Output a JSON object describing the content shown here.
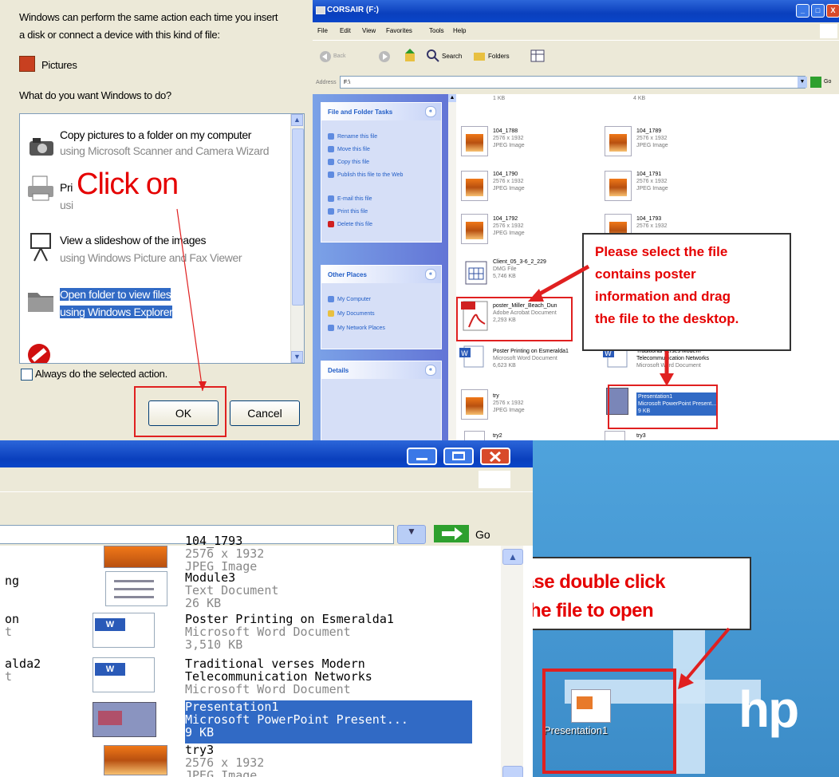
{
  "autoplay": {
    "intro_line1": "Windows can perform the same action each time you insert",
    "intro_line2": "a disk or connect a device with this kind of file:",
    "content_type": "Pictures",
    "question": "What do you want Windows to do?",
    "options": [
      {
        "line1": "Copy pictures to a folder on my computer",
        "line2": "using Microsoft Scanner and Camera Wizard"
      },
      {
        "line1": "Pri",
        "line2": "usi"
      },
      {
        "line1": "View a slideshow of the images",
        "line2": "using Windows Picture and Fax Viewer"
      },
      {
        "line1": "Open folder to view files",
        "line2": "using Windows Explorer"
      }
    ],
    "checkbox_label": "Always do the selected action.",
    "ok_label": "OK",
    "cancel_label": "Cancel",
    "annotation": "Click on"
  },
  "explorer": {
    "title": "CORSAIR (F:)",
    "menu": [
      "File",
      "Edit",
      "View",
      "Favorites",
      "Tools",
      "Help"
    ],
    "toolbar": {
      "back": "Back",
      "search": "Search",
      "folders": "Folders"
    },
    "address_label": "Address",
    "address_value": "F:\\",
    "go_label": "Go",
    "file_tasks_header": "File and Folder Tasks",
    "file_tasks": [
      "Rename this file",
      "Move this file",
      "Copy this file",
      "Publish this file to the Web",
      "E-mail this file",
      "Print this file",
      "Delete this file"
    ],
    "other_places_header": "Other Places",
    "other_places": [
      "My Computer",
      "My Documents",
      "My Network Places"
    ],
    "details_header": "Details",
    "files": [
      {
        "name": "104_1788",
        "l2": "2576 x 1932",
        "l3": "JPEG Image"
      },
      {
        "name": "104_1789",
        "l2": "2576 x 1932",
        "l3": "JPEG Image"
      },
      {
        "name": "104_1790",
        "l2": "2576 x 1932",
        "l3": "JPEG Image"
      },
      {
        "name": "104_1791",
        "l2": "2576 x 1932",
        "l3": "JPEG Image"
      },
      {
        "name": "104_1792",
        "l2": "2576 x 1932",
        "l3": "JPEG Image"
      },
      {
        "name": "104_1793",
        "l2": "2576 x 1932",
        "l3": ""
      },
      {
        "name": "Client_05_3-6_2_229",
        "l2": "DMG File",
        "l3": "5,746 KB"
      },
      {
        "name": "poster_Miller_Beach_Dun",
        "l2": "Adobe Acrobat Document",
        "l3": "2,293 KB"
      },
      {
        "name": "Poster Printing on Esmeralda1",
        "l2": "Microsoft Word Document",
        "l3": "6,623 KB"
      },
      {
        "name": "Traditional verses Modern",
        "l2": "Telecommunication Networks",
        "l3": "Microsoft Word Document"
      },
      {
        "name": "try",
        "l2": "2576 x 1932",
        "l3": "JPEG Image"
      },
      {
        "name": "Presentation1",
        "l2": "Microsoft PowerPoint Present...",
        "l3": "9 KB"
      },
      {
        "name": "try2",
        "l2": "",
        "l3": ""
      },
      {
        "name": "try3",
        "l2": "",
        "l3": ""
      },
      {
        "name": "1 KB",
        "l2": "",
        "l3": ""
      },
      {
        "name": "4 KB",
        "l2": "",
        "l3": ""
      }
    ],
    "callout_lines": [
      "Please select the file",
      "contains poster",
      "information and drag",
      "the file to the desktop."
    ]
  },
  "bottom_explorer": {
    "go_label": "Go",
    "left_fragments": [
      "ng",
      "on",
      "t",
      "alda2",
      "t"
    ],
    "files": [
      {
        "name": "104_1793",
        "l2": "2576 x 1932",
        "l3": "JPEG Image"
      },
      {
        "name": "Module3",
        "l2": "Text Document",
        "l3": "26 KB"
      },
      {
        "name": "Poster Printing on Esmeralda1",
        "l2": "Microsoft Word Document",
        "l3": "3,510 KB"
      },
      {
        "name": "Traditional verses Modern",
        "l2": "Telecommunication Networks",
        "l3": "Microsoft Word Document"
      },
      {
        "name": "Presentation1",
        "l2": "Microsoft PowerPoint Present...",
        "l3": "9 KB"
      },
      {
        "name": "try3",
        "l2": "2576 x 1932",
        "l3": "JPEG Image"
      }
    ]
  },
  "desktop": {
    "callout_line1": "Please double click",
    "callout_line2": "on the file to open",
    "icon_label": "Presentation1",
    "brand": "hp"
  },
  "colors": {
    "annotation_red": "#e50000",
    "xp_blue": "#0a3fbd",
    "selection": "#316ac5"
  }
}
